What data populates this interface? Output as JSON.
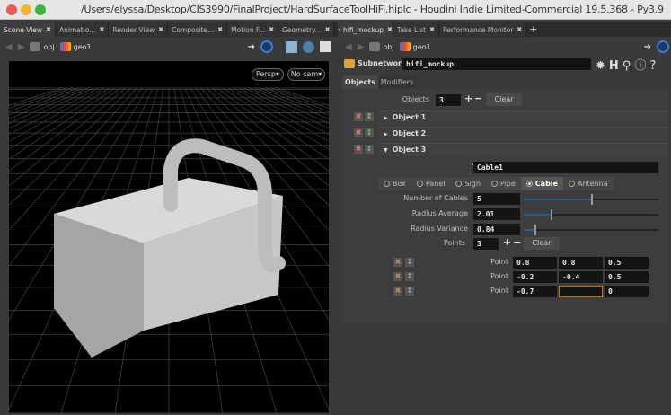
{
  "window": {
    "title": "/Users/elyssa/Desktop/CIS3990/FinalProject/HardSurfaceToolHiFi.hiplc - Houdini Indie Limited-Commercial 19.5.368 - Py3.9"
  },
  "left_pane": {
    "tabs": [
      {
        "label": "Scene View"
      },
      {
        "label": "Animatio..."
      },
      {
        "label": "Render View"
      },
      {
        "label": "Composite..."
      },
      {
        "label": "Motion F..."
      },
      {
        "label": "Geometry..."
      }
    ],
    "breadcrumb": {
      "obj": "obj",
      "geo": "geo1"
    },
    "viewport": {
      "persp": "Persp",
      "camera": "No cam"
    }
  },
  "right_pane": {
    "tabs": [
      {
        "label": "hifi_mockup"
      },
      {
        "label": "Take List"
      },
      {
        "label": "Performance Monitor"
      }
    ],
    "breadcrumb": {
      "obj": "obj",
      "geo": "geo1"
    },
    "node_type": "Subnetwork",
    "node_name": "hifi_mockup",
    "param_tabs": [
      {
        "label": "Objects"
      },
      {
        "label": "Modifiers"
      }
    ],
    "objects_label": "Objects",
    "objects_count": "3",
    "clear": "Clear",
    "objects": [
      {
        "label": "Object 1"
      },
      {
        "label": "Object 2"
      },
      {
        "label": "Object 3"
      }
    ],
    "name_label": "Name",
    "name_value": "Cable1",
    "types": [
      {
        "label": "Box"
      },
      {
        "label": "Panel"
      },
      {
        "label": "Sign"
      },
      {
        "label": "Pipe"
      },
      {
        "label": "Cable",
        "selected": true
      },
      {
        "label": "Antenna"
      }
    ],
    "params": [
      {
        "label": "Number of Cables",
        "value": "5",
        "fraction": 0.5
      },
      {
        "label": "Radius Average",
        "value": "2.01",
        "fraction": 0.2
      },
      {
        "label": "Radius Variance",
        "value": "0.84",
        "fraction": 0.08
      }
    ],
    "points_label": "Points",
    "points_count": "3",
    "point_label": "Point",
    "points": [
      [
        "0.8",
        "0.8",
        "0.5"
      ],
      [
        "-0.2",
        "-0.4",
        "0.5"
      ],
      [
        "-0.7",
        "",
        "0"
      ]
    ]
  },
  "colors": {
    "accent": "#2c5a8a",
    "field": "#141414"
  }
}
